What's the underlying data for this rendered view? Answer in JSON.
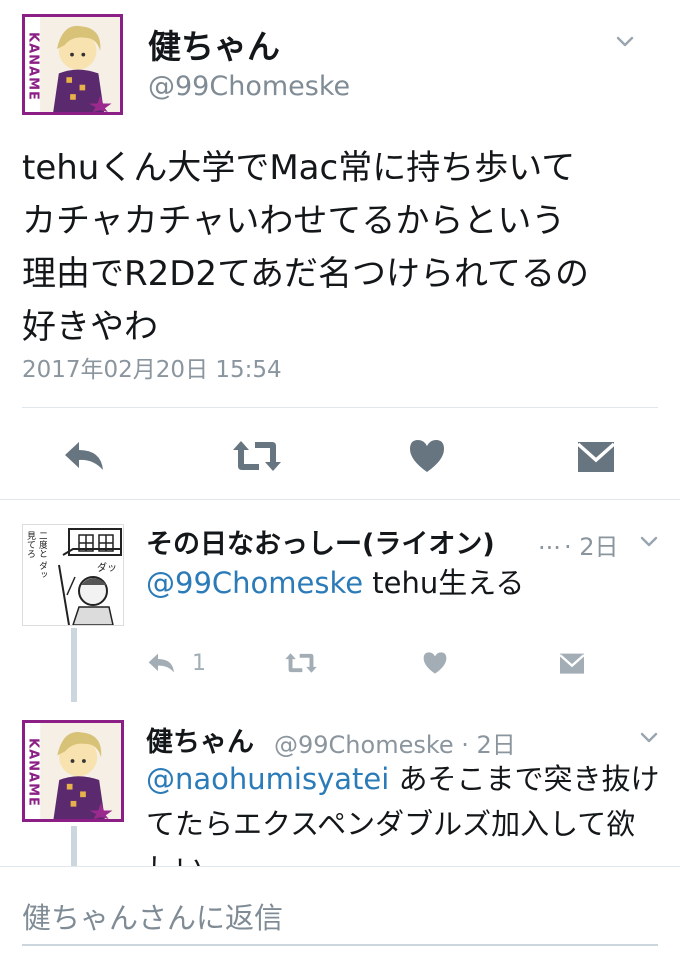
{
  "main_tweet": {
    "name": "健ちゃん",
    "handle": "@99Chomeske",
    "avatar_text": "KANAME",
    "text_lines": [
      "tehuくん大学でMac常に持ち歩いて",
      "カチャカチャいわせてるからという",
      "理由でR2D2てあだ名つけられてるの",
      "好きやわ"
    ],
    "timestamp": "2017年02月20日 15:54",
    "actions": {
      "reply_icon": "reply-icon",
      "retweet_icon": "retweet-icon",
      "like_icon": "heart-icon",
      "dm_icon": "envelope-icon"
    }
  },
  "replies": [
    {
      "name": "その日なおっしー(ライオン)",
      "ellipsis": "...",
      "time": "· 2日",
      "mention": "@99Chomeske",
      "text": " tehu生える",
      "reply_count": "1",
      "manga_text_a": "見てろ",
      "manga_text_b": "二度と ダッ",
      "manga_text_c": "ダッ"
    },
    {
      "name": "健ちゃん",
      "handle_time": "@99Chomeske · 2日",
      "avatar_text": "KANAME",
      "mention": "@naohumisyatei",
      "text_line1": " あそこまで突き抜け",
      "text_line2": "てたらエクスペンダブルズ加入して欲",
      "text_line3": "しい"
    }
  ],
  "reply_bar": {
    "placeholder": "健ちゃんさんに返信"
  },
  "colors": {
    "accent": "#2b7bb9",
    "icon_gray": "#66757f",
    "text_gray": "#8a959e",
    "avatar_border": "#8c1f86"
  }
}
